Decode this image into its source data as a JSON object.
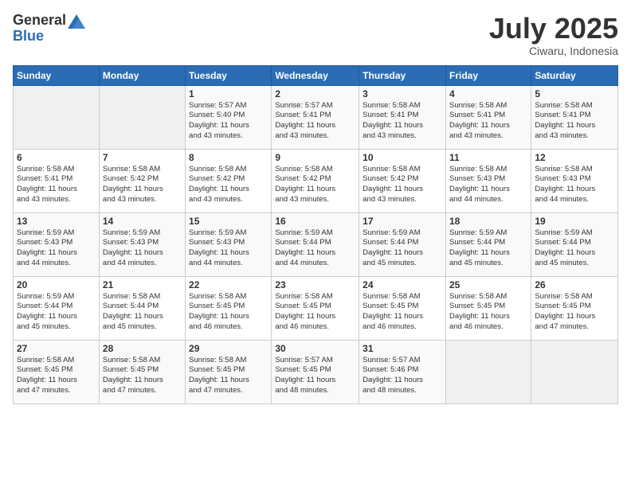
{
  "logo": {
    "general": "General",
    "blue": "Blue"
  },
  "header": {
    "title": "July 2025",
    "location": "Ciwaru, Indonesia"
  },
  "calendar": {
    "headers": [
      "Sunday",
      "Monday",
      "Tuesday",
      "Wednesday",
      "Thursday",
      "Friday",
      "Saturday"
    ],
    "weeks": [
      [
        {
          "day": "",
          "info": ""
        },
        {
          "day": "",
          "info": ""
        },
        {
          "day": "1",
          "info": "Sunrise: 5:57 AM\nSunset: 5:40 PM\nDaylight: 11 hours\nand 43 minutes."
        },
        {
          "day": "2",
          "info": "Sunrise: 5:57 AM\nSunset: 5:41 PM\nDaylight: 11 hours\nand 43 minutes."
        },
        {
          "day": "3",
          "info": "Sunrise: 5:58 AM\nSunset: 5:41 PM\nDaylight: 11 hours\nand 43 minutes."
        },
        {
          "day": "4",
          "info": "Sunrise: 5:58 AM\nSunset: 5:41 PM\nDaylight: 11 hours\nand 43 minutes."
        },
        {
          "day": "5",
          "info": "Sunrise: 5:58 AM\nSunset: 5:41 PM\nDaylight: 11 hours\nand 43 minutes."
        }
      ],
      [
        {
          "day": "6",
          "info": "Sunrise: 5:58 AM\nSunset: 5:41 PM\nDaylight: 11 hours\nand 43 minutes."
        },
        {
          "day": "7",
          "info": "Sunrise: 5:58 AM\nSunset: 5:42 PM\nDaylight: 11 hours\nand 43 minutes."
        },
        {
          "day": "8",
          "info": "Sunrise: 5:58 AM\nSunset: 5:42 PM\nDaylight: 11 hours\nand 43 minutes."
        },
        {
          "day": "9",
          "info": "Sunrise: 5:58 AM\nSunset: 5:42 PM\nDaylight: 11 hours\nand 43 minutes."
        },
        {
          "day": "10",
          "info": "Sunrise: 5:58 AM\nSunset: 5:42 PM\nDaylight: 11 hours\nand 43 minutes."
        },
        {
          "day": "11",
          "info": "Sunrise: 5:58 AM\nSunset: 5:43 PM\nDaylight: 11 hours\nand 44 minutes."
        },
        {
          "day": "12",
          "info": "Sunrise: 5:58 AM\nSunset: 5:43 PM\nDaylight: 11 hours\nand 44 minutes."
        }
      ],
      [
        {
          "day": "13",
          "info": "Sunrise: 5:59 AM\nSunset: 5:43 PM\nDaylight: 11 hours\nand 44 minutes."
        },
        {
          "day": "14",
          "info": "Sunrise: 5:59 AM\nSunset: 5:43 PM\nDaylight: 11 hours\nand 44 minutes."
        },
        {
          "day": "15",
          "info": "Sunrise: 5:59 AM\nSunset: 5:43 PM\nDaylight: 11 hours\nand 44 minutes."
        },
        {
          "day": "16",
          "info": "Sunrise: 5:59 AM\nSunset: 5:44 PM\nDaylight: 11 hours\nand 44 minutes."
        },
        {
          "day": "17",
          "info": "Sunrise: 5:59 AM\nSunset: 5:44 PM\nDaylight: 11 hours\nand 45 minutes."
        },
        {
          "day": "18",
          "info": "Sunrise: 5:59 AM\nSunset: 5:44 PM\nDaylight: 11 hours\nand 45 minutes."
        },
        {
          "day": "19",
          "info": "Sunrise: 5:59 AM\nSunset: 5:44 PM\nDaylight: 11 hours\nand 45 minutes."
        }
      ],
      [
        {
          "day": "20",
          "info": "Sunrise: 5:59 AM\nSunset: 5:44 PM\nDaylight: 11 hours\nand 45 minutes."
        },
        {
          "day": "21",
          "info": "Sunrise: 5:58 AM\nSunset: 5:44 PM\nDaylight: 11 hours\nand 45 minutes."
        },
        {
          "day": "22",
          "info": "Sunrise: 5:58 AM\nSunset: 5:45 PM\nDaylight: 11 hours\nand 46 minutes."
        },
        {
          "day": "23",
          "info": "Sunrise: 5:58 AM\nSunset: 5:45 PM\nDaylight: 11 hours\nand 46 minutes."
        },
        {
          "day": "24",
          "info": "Sunrise: 5:58 AM\nSunset: 5:45 PM\nDaylight: 11 hours\nand 46 minutes."
        },
        {
          "day": "25",
          "info": "Sunrise: 5:58 AM\nSunset: 5:45 PM\nDaylight: 11 hours\nand 46 minutes."
        },
        {
          "day": "26",
          "info": "Sunrise: 5:58 AM\nSunset: 5:45 PM\nDaylight: 11 hours\nand 47 minutes."
        }
      ],
      [
        {
          "day": "27",
          "info": "Sunrise: 5:58 AM\nSunset: 5:45 PM\nDaylight: 11 hours\nand 47 minutes."
        },
        {
          "day": "28",
          "info": "Sunrise: 5:58 AM\nSunset: 5:45 PM\nDaylight: 11 hours\nand 47 minutes."
        },
        {
          "day": "29",
          "info": "Sunrise: 5:58 AM\nSunset: 5:45 PM\nDaylight: 11 hours\nand 47 minutes."
        },
        {
          "day": "30",
          "info": "Sunrise: 5:57 AM\nSunset: 5:45 PM\nDaylight: 11 hours\nand 48 minutes."
        },
        {
          "day": "31",
          "info": "Sunrise: 5:57 AM\nSunset: 5:46 PM\nDaylight: 11 hours\nand 48 minutes."
        },
        {
          "day": "",
          "info": ""
        },
        {
          "day": "",
          "info": ""
        }
      ]
    ]
  }
}
